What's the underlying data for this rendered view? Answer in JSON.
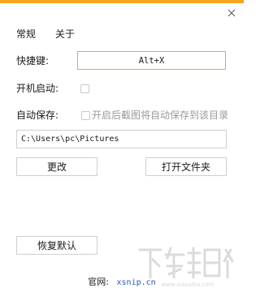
{
  "window": {
    "accent_color": "#f5a623",
    "close_icon": "close-icon"
  },
  "tabs": [
    {
      "label": "常规"
    },
    {
      "label": "关于"
    }
  ],
  "hotkey": {
    "label": "快捷键:",
    "value": "Alt+X"
  },
  "startup": {
    "label": "开机启动:",
    "checked": false
  },
  "autosave": {
    "label": "自动保存:",
    "checkbox_text": "开启后截图将自动保存到该目录",
    "checked": false
  },
  "path": {
    "value": "C:\\Users\\pc\\Pictures"
  },
  "buttons": {
    "change": "更改",
    "open_folder": "打开文件夹",
    "restore_defaults": "恢复默认"
  },
  "website": {
    "label": "官网:",
    "url": "xsnip.cn",
    "link_color": "#2c5aa8"
  },
  "watermark": {
    "text": "下载吧",
    "domain": "www.xiazaiba.com"
  }
}
